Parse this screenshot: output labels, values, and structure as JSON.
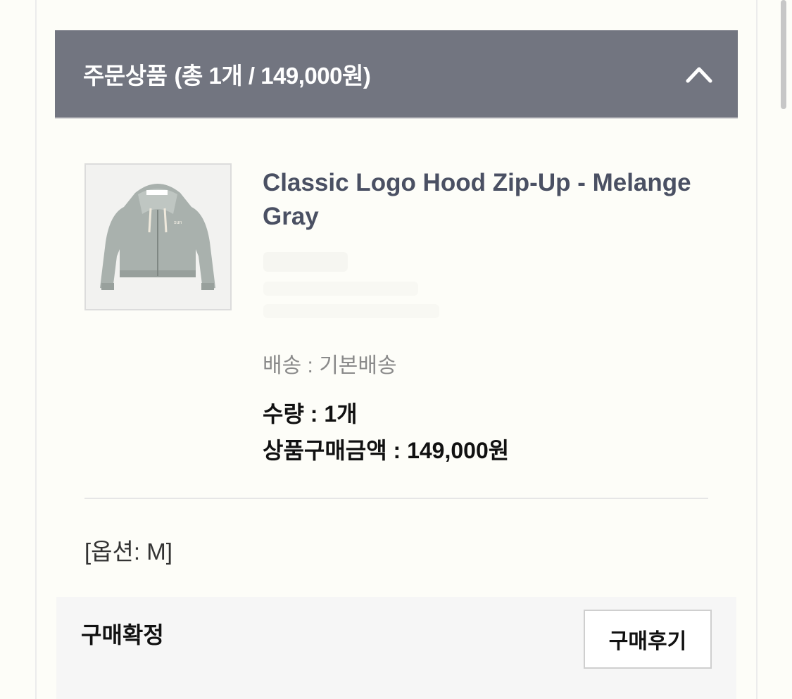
{
  "order_panel": {
    "title": "주문상품",
    "summary": "(총 1개 / 149,000원)",
    "toggle_icon": "chevron-up-icon",
    "header_color": "#727580"
  },
  "product": {
    "image_icon": "hoodie-thumbnail",
    "name": "Classic Logo Hood Zip-Up - Melange Gray",
    "shipping": "배송 : 기본배송",
    "quantity": "수량 : 1개",
    "price": "상품구매금액 : 149,000원",
    "option": "[옵션: M]"
  },
  "actions": {
    "status": "구매확정",
    "review_button": "구매후기"
  }
}
